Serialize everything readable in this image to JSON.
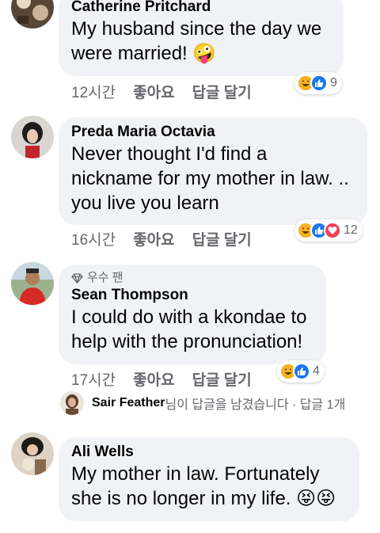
{
  "comments": [
    {
      "author": "Catherine Pritchard",
      "text_lines": [
        "My husband since the day we",
        "were married! 🤪"
      ],
      "time": "12시간",
      "like": "좋아요",
      "reply": "답글 달기",
      "reaction_icons": [
        "haha-icon",
        "like-icon"
      ],
      "reaction_count": "9"
    },
    {
      "author": "Preda Maria Octavia",
      "text_lines": [
        "Never thought I'd find a",
        "nickname for my mother in law. ..",
        "you live you learn"
      ],
      "time": "16시간",
      "like": "좋아요",
      "reply": "답글 달기",
      "reaction_icons": [
        "haha-icon",
        "like-icon",
        "love-icon"
      ],
      "reaction_count": "12"
    },
    {
      "badge": "우수 팬",
      "author": "Sean Thompson",
      "text_lines": [
        "I could do with a kkondae to",
        "help with the pronunciation!"
      ],
      "time": "17시간",
      "like": "좋아요",
      "reply": "답글 달기",
      "reaction_icons": [
        "haha-icon",
        "like-icon"
      ],
      "reaction_count": "4",
      "replies": {
        "name": "Sair Feather",
        "text": "님이 답글을 남겼습니다 · 답글 1개"
      }
    },
    {
      "author": "Ali Wells",
      "text_lines": [
        "My mother in law. Fortunately",
        "she is no longer in my life. 😝😝"
      ]
    }
  ],
  "colors": {
    "bubble": "#f0f2f5",
    "secondary_text": "#65676b",
    "like_blue": "#1877f2",
    "love_red": "#f33e58",
    "haha_yellow": "#f7b125"
  }
}
